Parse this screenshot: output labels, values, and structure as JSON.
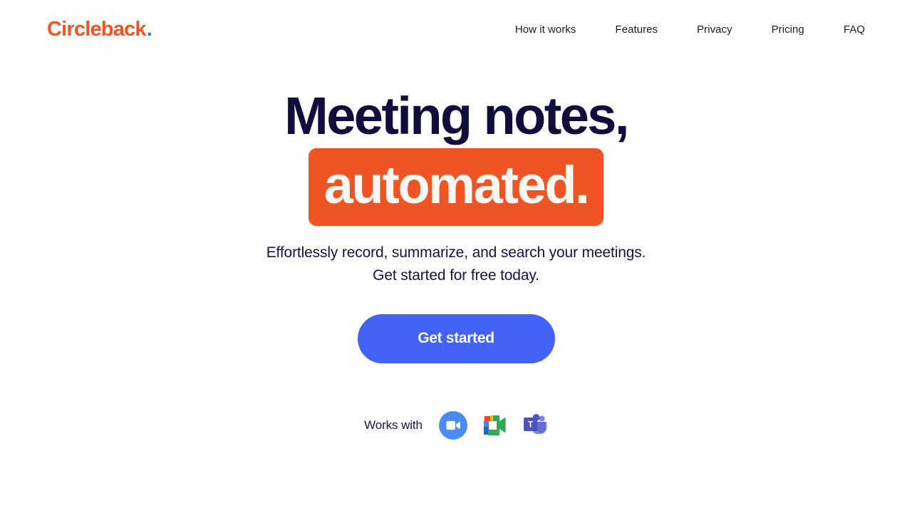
{
  "brand": {
    "name": "Circleback",
    "dot": ".",
    "logo_color": "#ef5425",
    "dot_color": "#4263f5"
  },
  "nav": {
    "items": [
      {
        "label": "How it works"
      },
      {
        "label": "Features"
      },
      {
        "label": "Privacy"
      },
      {
        "label": "Pricing"
      },
      {
        "label": "FAQ"
      }
    ]
  },
  "hero": {
    "headline_line1": "Meeting notes,",
    "headline_line2": "automated.",
    "highlight_bg": "#ef5425",
    "highlight_text_color": "#fbf7f2",
    "headline_color": "#110d3d",
    "subtitle_line1": "Effortlessly record, summarize, and search your meetings.",
    "subtitle_line2": "Get started for free today.",
    "cta_label": "Get started",
    "cta_bg": "#4263f5",
    "cta_text_color": "#ffffff"
  },
  "integrations": {
    "label": "Works with",
    "items": [
      {
        "name": "zoom-icon",
        "title": "Zoom"
      },
      {
        "name": "google-meet-icon",
        "title": "Google Meet"
      },
      {
        "name": "microsoft-teams-icon",
        "title": "Microsoft Teams"
      }
    ]
  }
}
